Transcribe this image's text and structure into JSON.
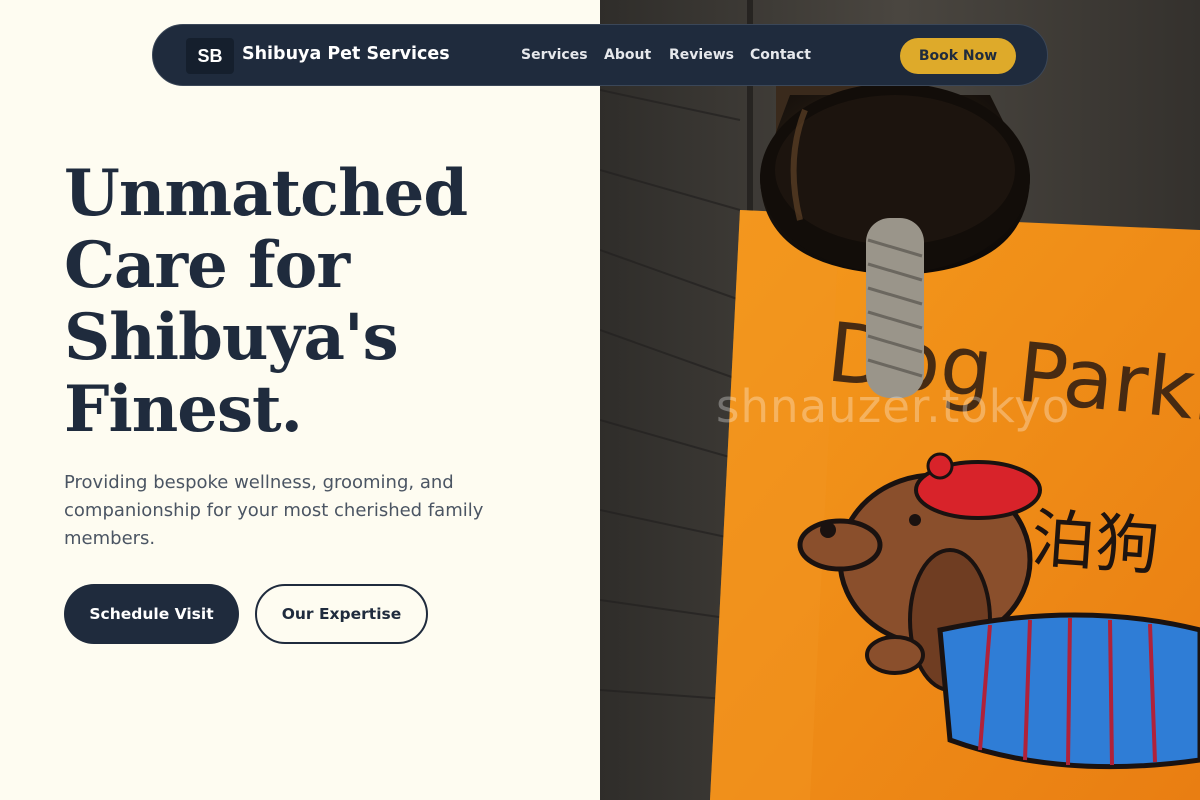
{
  "colors": {
    "background": "#fefcf1",
    "navy": "#1f2b3d",
    "accent_gold": "#deaa2a",
    "sign_orange": "#f08a15",
    "muted_text": "#4b5563"
  },
  "nav": {
    "logo_initials": "SB",
    "brand_name": "Shibuya Pet Services",
    "links": [
      "Services",
      "About",
      "Reviews",
      "Contact"
    ],
    "cta_label": "Book Now"
  },
  "hero": {
    "title_lines": [
      "Unmatched",
      "Care for",
      "Shibuya's",
      "Finest."
    ],
    "subtitle": "Providing bespoke wellness, grooming, and companionship for your most cherished family members.",
    "primary_button": "Schedule Visit",
    "secondary_button": "Our Expertise"
  },
  "photo": {
    "watermark": "shnauzer.tokyo",
    "sign_text_latin": "Dog Parkin",
    "sign_text_kanji": "泊狗"
  }
}
